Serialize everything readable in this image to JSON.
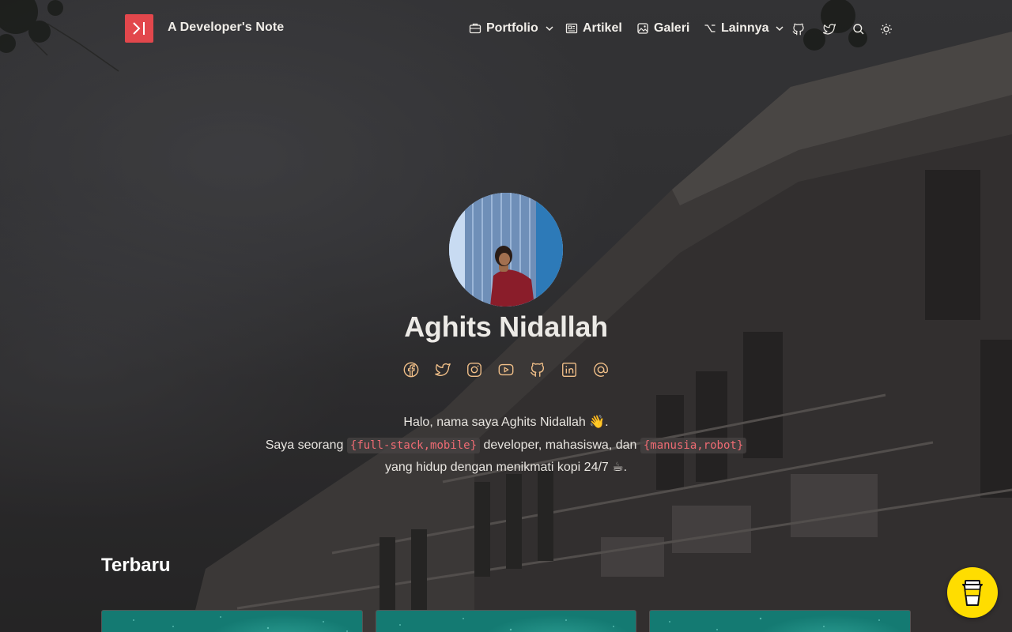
{
  "site": {
    "title": "A Developer's Note",
    "logo_icon": "skip-forward-icon",
    "accent_color": "#e2474c"
  },
  "nav": {
    "items": [
      {
        "label": "Portfolio",
        "icon": "briefcase-icon",
        "has_dropdown": true
      },
      {
        "label": "Artikel",
        "icon": "newspaper-icon",
        "has_dropdown": false
      },
      {
        "label": "Galeri",
        "icon": "photo-icon",
        "has_dropdown": false
      },
      {
        "label": "Lainnya",
        "icon": "option-key-icon",
        "has_dropdown": true
      }
    ],
    "icon_buttons": [
      "github-icon",
      "twitter-icon",
      "search-icon",
      "sun-icon"
    ]
  },
  "hero": {
    "name": "Aghits Nidallah",
    "socials": [
      "facebook-icon",
      "twitter-icon",
      "instagram-icon",
      "youtube-icon",
      "github-icon",
      "linkedin-icon",
      "at-sign-icon"
    ],
    "bio": {
      "line1": "Halo, nama saya Aghits Nidallah 👋.",
      "line2_before": "Saya seorang ",
      "line2_code1": "{full-stack,mobile}",
      "line2_middle": " developer, mahasiswa, dan ",
      "line2_code2": "{manusia,robot}",
      "line3": "yang hidup dengan menikmati kopi 24/7 ☕."
    }
  },
  "latest": {
    "title": "Terbaru"
  },
  "floating": {
    "coffee_button_icon": "coffee-cup-icon",
    "coffee_button_color": "#ffdd00"
  }
}
